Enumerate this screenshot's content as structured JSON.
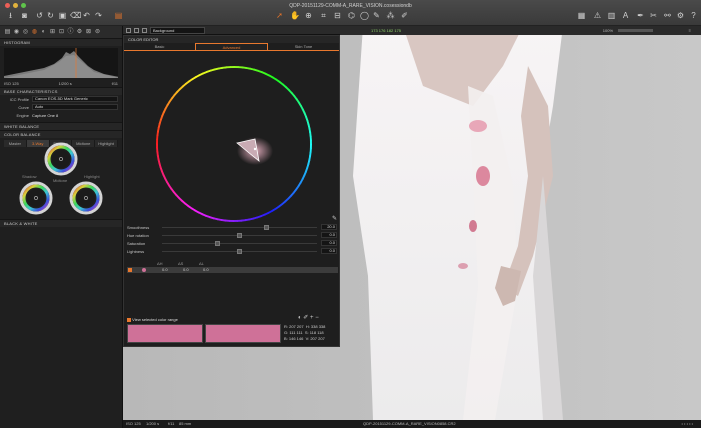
{
  "window": {
    "title": "QDP-20151129-COMM-A_RARE_VISION.cosessiondb"
  },
  "toolbar": {
    "left_icons": [
      "import-icon",
      "camera-icon",
      "rotate-left-icon",
      "rotate-right-icon",
      "folder-icon",
      "trash-icon",
      "undo-icon",
      "redo-icon",
      "session-icon"
    ],
    "center_icons": [
      "cursor-icon",
      "pan-icon",
      "zoom-icon",
      "crop-icon",
      "straighten-icon",
      "keystone-icon",
      "mask-icon",
      "brush-icon",
      "picker-icon",
      "color-picker-icon"
    ],
    "right_icons": [
      "grid-view-icon",
      "warning-icon",
      "focus-icon",
      "text-icon",
      "pen-icon",
      "tools-icon",
      "settings-icon",
      "help-icon"
    ]
  },
  "left_panel": {
    "tool_tabs": [
      "library-tab",
      "capture-tab",
      "lens-tab",
      "color-tab",
      "exposure-tab",
      "detail-tab",
      "local-tab",
      "metadata-tab",
      "output-tab",
      "batch-tab",
      "settings-tab",
      "styles-tab"
    ],
    "histogram": {
      "title": "HISTOGRAM",
      "iso": "ISO 125",
      "shutter": "1/200 s",
      "aperture": "f/11"
    },
    "base_characteristics": {
      "title": "BASE CHARACTERISTICS",
      "icc_label": "ICC Profile",
      "icc_value": "Canon EOS-5D Mark Generic",
      "curve_label": "Curve",
      "curve_value": "Auto",
      "engine_label": "Engine",
      "engine_value": "Capture One 8"
    },
    "white_balance": {
      "title": "WHITE BALANCE"
    },
    "color_balance": {
      "title": "COLOR BALANCE",
      "tabs": [
        "Master",
        "3-Way",
        "Shadow",
        "Midtone",
        "Highlight"
      ],
      "active_tab": "3-Way",
      "labels": {
        "shadow": "Shadow",
        "midtone": "Midtone",
        "highlight": "Highlight"
      }
    },
    "black_white": {
      "title": "BLACK & WHITE"
    }
  },
  "viewer_bar": {
    "layer_value": "Background",
    "readout": "173  176  182  175",
    "zoom": "100%"
  },
  "color_editor": {
    "title": "COLOR EDITOR",
    "tabs": [
      "Basic",
      "Advanced",
      "Skin Tone"
    ],
    "active_tab": "Advanced",
    "sliders": [
      {
        "label": "Smoothness",
        "value": "20.0",
        "pos": 0.68
      },
      {
        "label": "Hue rotation",
        "value": "0.0",
        "pos": 0.5
      },
      {
        "label": "Saturation",
        "value": "0.0",
        "pos": 0.35
      },
      {
        "label": "Lightness",
        "value": "0.0",
        "pos": 0.5
      }
    ],
    "range_head": [
      "ΔH",
      "ΔS",
      "ΔL"
    ],
    "range_row": [
      "0.0",
      "0.0",
      "0.0"
    ],
    "view_selected_label": "View selected color range",
    "swatch_colors": [
      "#cf7198",
      "#cf7198"
    ],
    "readout": {
      "r": "R: 207  207",
      "g": "G: 111  111",
      "b": "B: 146  146",
      "h": "H: 338  338",
      "s": "S: 118  118",
      "v": "V: 207  207"
    }
  },
  "status_bar": {
    "iso": "ISO 125",
    "shutter": "1/200 s",
    "aperture": "f/11",
    "focal": "85 mm",
    "filename": "QDP-20151129-COMM-A_RARE_VISION0858.CR2"
  },
  "colors": {
    "accent": "#e8782e",
    "panel_bg": "#1e1e1e",
    "toolbar_bg": "#3e3e3e",
    "viewer_bg": "#bdbdbd",
    "swatch": "#cf7198"
  }
}
